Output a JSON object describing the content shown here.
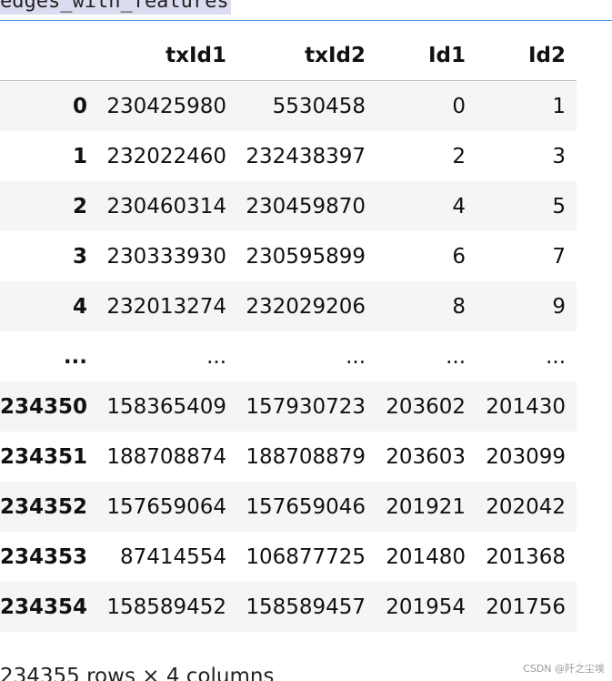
{
  "cell": {
    "code": "edges_with_features"
  },
  "table": {
    "columns": [
      "",
      "txId1",
      "txId2",
      "Id1",
      "Id2"
    ],
    "rows": [
      [
        "0",
        "230425980",
        "5530458",
        "0",
        "1"
      ],
      [
        "1",
        "232022460",
        "232438397",
        "2",
        "3"
      ],
      [
        "2",
        "230460314",
        "230459870",
        "4",
        "5"
      ],
      [
        "3",
        "230333930",
        "230595899",
        "6",
        "7"
      ],
      [
        "4",
        "232013274",
        "232029206",
        "8",
        "9"
      ],
      [
        "...",
        "...",
        "...",
        "...",
        "..."
      ],
      [
        "234350",
        "158365409",
        "157930723",
        "203602",
        "201430"
      ],
      [
        "234351",
        "188708874",
        "188708879",
        "203603",
        "203099"
      ],
      [
        "234352",
        "157659064",
        "157659046",
        "201921",
        "202042"
      ],
      [
        "234353",
        "87414554",
        "106877725",
        "201480",
        "201368"
      ],
      [
        "234354",
        "158589452",
        "158589457",
        "201954",
        "201756"
      ]
    ]
  },
  "footer": {
    "summary": "234355 rows × 4 columns"
  },
  "watermark": {
    "text": "CSDN @阡之尘埃"
  }
}
